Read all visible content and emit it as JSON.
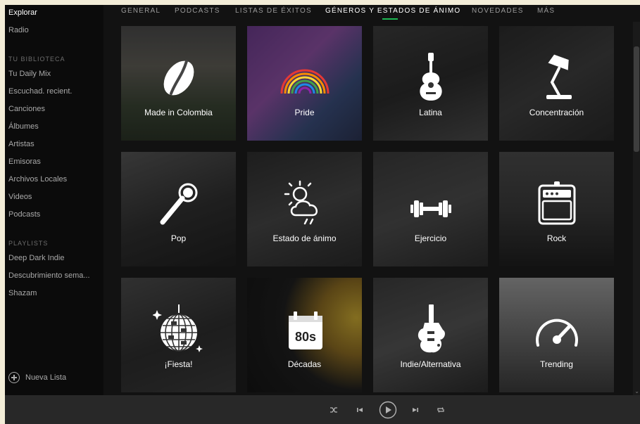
{
  "sidebar": {
    "nav": [
      "Explorar",
      "Radio"
    ],
    "library_heading": "TU BIBLIOTECA",
    "library": [
      "Tu Daily Mix",
      "Escuchad. recient.",
      "Canciones",
      "Álbumes",
      "Artistas",
      "Emisoras",
      "Archivos Locales",
      "Videos",
      "Podcasts"
    ],
    "playlists_heading": "PLAYLISTS",
    "playlists": [
      "Deep Dark Indie",
      "Descubrimiento sema...",
      "Shazam"
    ],
    "new_list": "Nueva Lista"
  },
  "tabs": [
    {
      "label": "GENERAL"
    },
    {
      "label": "PODCASTS"
    },
    {
      "label": "LISTAS DE ÉXITOS"
    },
    {
      "label": "GÉNEROS Y ESTADOS DE ÁNIMO",
      "active": true
    },
    {
      "label": "NOVEDADES"
    },
    {
      "label": "MÁS"
    }
  ],
  "tiles": [
    {
      "label": "Made in Colombia",
      "icon": "coffee-bean-icon",
      "bg": "linear-gradient(180deg,#4a4a4a 0%,#5e5c55 35%,#3a4434 70%,#2a3326 100%)"
    },
    {
      "label": "Pride",
      "icon": "rainbow-icon",
      "bg": "linear-gradient(135deg,#6a3b8a 0%,#8a4fa0 40%,#3a4d7a 70%,#2b3350 100%)"
    },
    {
      "label": "Latina",
      "icon": "guitar-icon",
      "bg": "linear-gradient(160deg,#3c3c3c 0%,#2a2a2a 50%,#4a4a4a 100%)"
    },
    {
      "label": "Concentración",
      "icon": "desk-lamp-icon",
      "bg": "linear-gradient(150deg,#2b2b2b 0%,#3e3e3e 50%,#282828 100%)"
    },
    {
      "label": "Pop",
      "icon": "microphone-icon",
      "bg": "linear-gradient(160deg,#555 0%,#2f2f2f 55%,#1e1e1e 100%)"
    },
    {
      "label": "Estado de ánimo",
      "icon": "weather-icon",
      "bg": "linear-gradient(160deg,#2e2e2e 0%,#454545 50%,#2a2a2a 100%)"
    },
    {
      "label": "Ejercicio",
      "icon": "dumbbell-icon",
      "bg": "linear-gradient(160deg,#3a3a3a 0%,#4c4c4c 50%,#2c2c2c 100%)"
    },
    {
      "label": "Rock",
      "icon": "amplifier-icon",
      "bg": "linear-gradient(180deg,#4a4a4a 0%,#3a3a3a 50%,#1e1e1e 100%)"
    },
    {
      "label": "¡Fiesta!",
      "icon": "disco-ball-icon",
      "bg": "linear-gradient(160deg,#4b4b4b 0%,#2d2d2d 55%,#3a3a3a 100%)"
    },
    {
      "label": "Décadas",
      "icon": "calendar-80s-icon",
      "bg": "radial-gradient(circle at 95% 35%,#c9a832 0%,#8a6a22 28%,#1f1f1f 55%,#141414 100%)"
    },
    {
      "label": "Indie/Alternativa",
      "icon": "electric-guitar-icon",
      "bg": "linear-gradient(160deg,#3c3c3c 0%,#545454 50%,#2b2b2b 100%)"
    },
    {
      "label": "Trending",
      "icon": "speedometer-icon",
      "bg": "linear-gradient(180deg,#9a9a9a 0%,#6e6e6e 45%,#3a3a3a 100%)"
    }
  ],
  "player": {
    "shuffle_icon": "shuffle-icon",
    "prev_icon": "previous-icon",
    "play_icon": "play-icon",
    "next_icon": "next-icon",
    "repeat_icon": "repeat-icon"
  },
  "colors": {
    "accent": "#1db954",
    "sidebar_bg": "#0b0b0b",
    "main_bg": "#121212",
    "player_bg": "#282828"
  }
}
